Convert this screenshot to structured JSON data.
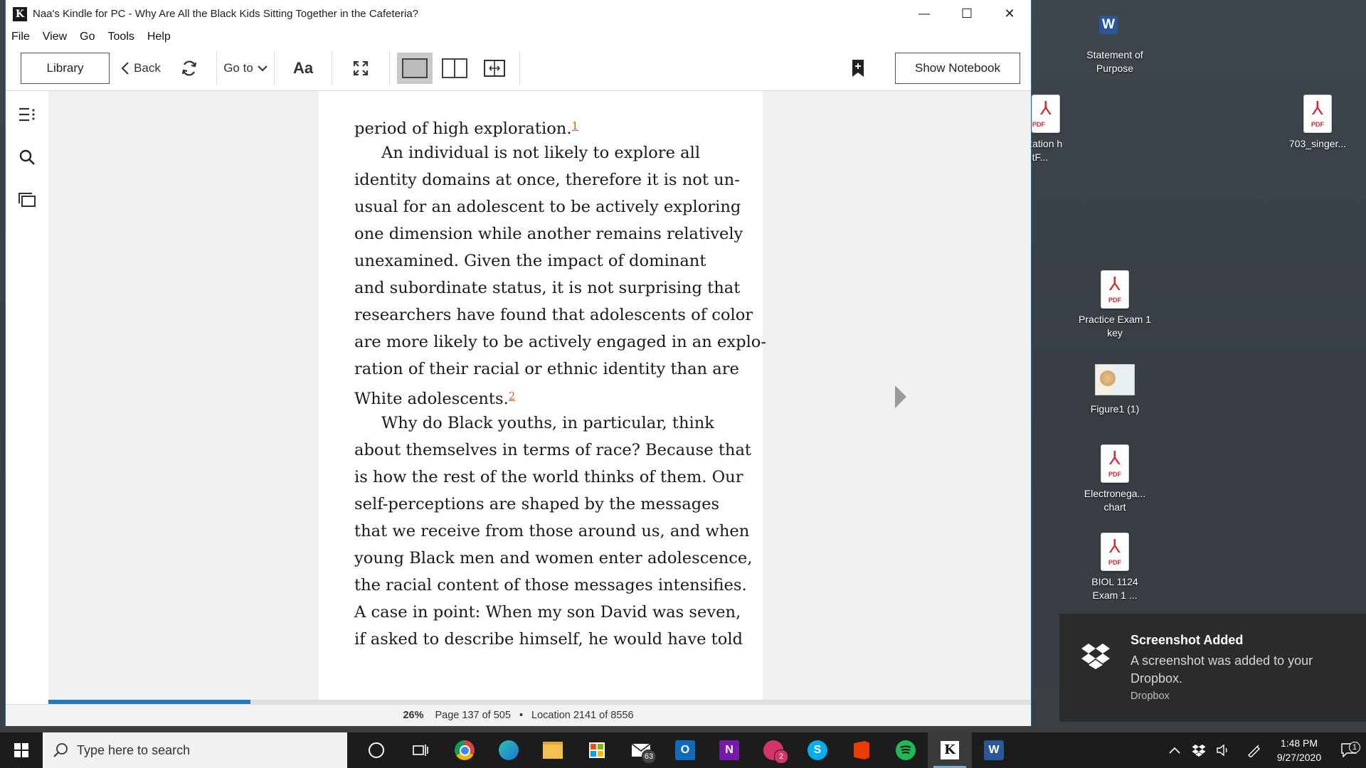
{
  "window": {
    "title": "Naa's Kindle for PC - Why Are All the Black Kids Sitting Together in the Cafeteria?",
    "logo": "K",
    "controls": {
      "minimize": "—",
      "maximize": "☐",
      "close": "✕"
    }
  },
  "menu": [
    "File",
    "View",
    "Go",
    "Tools",
    "Help"
  ],
  "toolbar": {
    "library": "Library",
    "back": "Back",
    "goto": "Go to",
    "font": "Aa",
    "show_notebook": "Show Notebook"
  },
  "reader": {
    "lines": [
      {
        "text": "period of high exploration.",
        "note": "1",
        "indent": false
      },
      {
        "text": "An individual is not likely to explore all",
        "indent": true
      },
      {
        "text": "identity domains at once, therefore it is not un-",
        "indent": false
      },
      {
        "text": "usual for an adolescent to be actively exploring",
        "indent": false
      },
      {
        "text": "one dimension while another remains relatively",
        "indent": false
      },
      {
        "text": "unexamined. Given the impact of dominant",
        "indent": false
      },
      {
        "text": "and subordinate status, it is not surprising that",
        "indent": false
      },
      {
        "text": "researchers have found that adolescents of color",
        "indent": false
      },
      {
        "text": "are more likely to be actively engaged in an explo-",
        "indent": false
      },
      {
        "text": "ration of their racial or ethnic identity than are",
        "indent": false
      },
      {
        "text": "White adolescents.",
        "note": "2",
        "indent": false
      },
      {
        "text": "Why do Black youths, in particular, think",
        "indent": true
      },
      {
        "text": "about themselves in terms of race? Because that",
        "indent": false
      },
      {
        "text": "is how the rest of the world thinks of them. Our",
        "indent": false
      },
      {
        "text": "self-perceptions are shaped by the messages",
        "indent": false
      },
      {
        "text": "that we receive from those around us, and when",
        "indent": false
      },
      {
        "text": "young Black men and women enter adolescence,",
        "indent": false
      },
      {
        "text": "the racial content of those messages intensifies.",
        "indent": false
      },
      {
        "text": "A case in point: When my son David was seven,",
        "indent": false
      },
      {
        "text": "if asked to describe himself, he would have told",
        "indent": false
      }
    ],
    "progress_fraction": 0.206
  },
  "status": {
    "percent": "26%",
    "page": "Page 137 of 505",
    "separator": "•",
    "location": "Location 2141 of 8556"
  },
  "desktop_icons": [
    {
      "label": "Statement of Purpose",
      "type": "word"
    },
    {
      "label": "mentation h YeastF...",
      "type": "pdf"
    },
    {
      "label": "703_singer...",
      "type": "pdf"
    },
    {
      "label": "Practice Exam 1 key",
      "type": "pdf"
    },
    {
      "label": "Figure1 (1)",
      "type": "image"
    },
    {
      "label": "Electronega... chart",
      "type": "pdf"
    },
    {
      "label": "BIOL 1124 Exam 1 ...",
      "type": "pdf"
    }
  ],
  "pdf_tag": "PDF",
  "toast": {
    "title": "Screenshot Added",
    "message": "A screenshot was added to your Dropbox.",
    "source": "Dropbox"
  },
  "taskbar": {
    "search_placeholder": "Type here to search",
    "mail_badge": "63",
    "teams_badge": "2",
    "time": "1:48 PM",
    "date": "9/27/2020",
    "notif_count": "1"
  }
}
